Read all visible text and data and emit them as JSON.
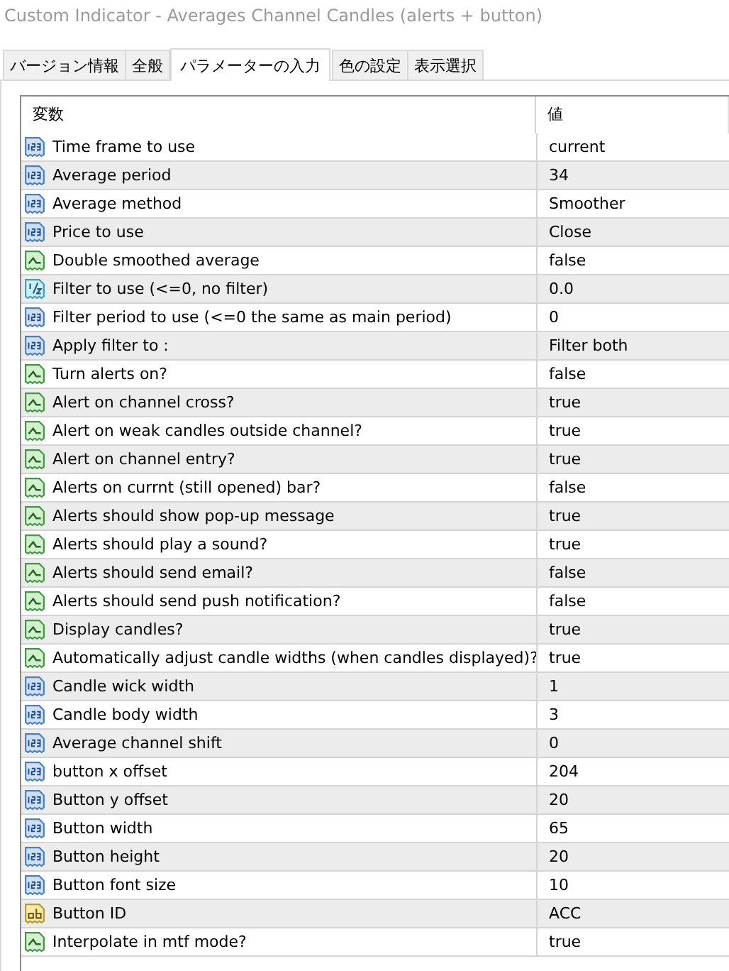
{
  "window": {
    "title": "Custom Indicator - Averages Channel Candles  (alerts + button)"
  },
  "tabs": [
    {
      "label": "バージョン情報",
      "selected": false
    },
    {
      "label": "全般",
      "selected": false
    },
    {
      "label": "パラメーターの入力",
      "selected": true
    },
    {
      "label": "色の設定",
      "selected": false
    },
    {
      "label": "表示選択",
      "selected": false
    }
  ],
  "table": {
    "columns": [
      "変数",
      "値"
    ],
    "rows": [
      {
        "kind": "integer",
        "name": "Time frame to use",
        "value": "current"
      },
      {
        "kind": "integer",
        "name": "Average period",
        "value": "34"
      },
      {
        "kind": "integer",
        "name": "Average method",
        "value": "Smoother"
      },
      {
        "kind": "integer",
        "name": "Price to use",
        "value": "Close"
      },
      {
        "kind": "boolean",
        "name": "Double smoothed average",
        "value": "false"
      },
      {
        "kind": "double",
        "name": "Filter to use (<=0, no filter)",
        "value": "0.0"
      },
      {
        "kind": "integer",
        "name": "Filter period to use (<=0 the same as main period)",
        "value": "0"
      },
      {
        "kind": "integer",
        "name": "Apply filter to :",
        "value": "Filter both"
      },
      {
        "kind": "boolean",
        "name": "Turn alerts on?",
        "value": "false"
      },
      {
        "kind": "boolean",
        "name": "Alert on channel cross?",
        "value": "true"
      },
      {
        "kind": "boolean",
        "name": "Alert on weak candles outside channel?",
        "value": "true"
      },
      {
        "kind": "boolean",
        "name": "Alert on channel entry?",
        "value": "true"
      },
      {
        "kind": "boolean",
        "name": "Alerts on currnt (still opened) bar?",
        "value": "false"
      },
      {
        "kind": "boolean",
        "name": "Alerts should show pop-up message",
        "value": "true"
      },
      {
        "kind": "boolean",
        "name": "Alerts should play a sound?",
        "value": "true"
      },
      {
        "kind": "boolean",
        "name": "Alerts should send email?",
        "value": "false"
      },
      {
        "kind": "boolean",
        "name": "Alerts should send push notification?",
        "value": "false"
      },
      {
        "kind": "boolean",
        "name": "Display candles?",
        "value": "true"
      },
      {
        "kind": "boolean",
        "name": "Automatically adjust candle widths (when candles displayed)?",
        "value": "true"
      },
      {
        "kind": "integer",
        "name": "Candle wick width",
        "value": "1"
      },
      {
        "kind": "integer",
        "name": "Candle body width",
        "value": "3"
      },
      {
        "kind": "integer",
        "name": "Average channel shift",
        "value": "0"
      },
      {
        "kind": "integer",
        "name": "button x offset",
        "value": "204"
      },
      {
        "kind": "integer",
        "name": "Button y offset",
        "value": "20"
      },
      {
        "kind": "integer",
        "name": "Button width",
        "value": "65"
      },
      {
        "kind": "integer",
        "name": "Button height",
        "value": "20"
      },
      {
        "kind": "integer",
        "name": "Button font size",
        "value": "10"
      },
      {
        "kind": "string",
        "name": "Button ID",
        "value": "ACC"
      },
      {
        "kind": "boolean",
        "name": "Interpolate in mtf mode?",
        "value": "true"
      }
    ]
  }
}
